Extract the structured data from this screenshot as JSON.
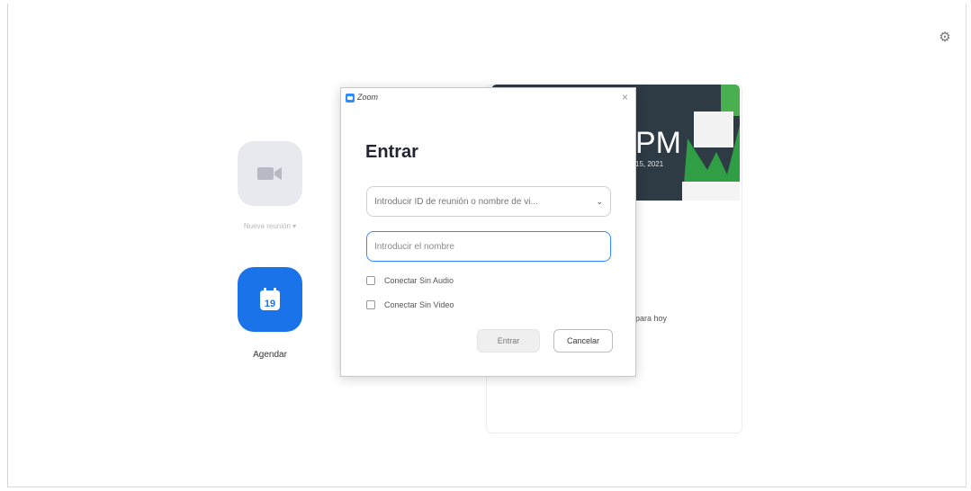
{
  "dialog": {
    "window_title": "Zoom",
    "close_glyph": "×",
    "heading": "Entrar",
    "meeting_select_placeholder": "Introducir ID de reunión o nombre de vi...",
    "name_placeholder": "Introducir el nombre",
    "checkbox_no_audio": "Conectar Sin Audio",
    "checkbox_no_video": "Conectar Sin Video",
    "join_button": "Entrar",
    "cancel_button": "Cancelar"
  },
  "launcher": {
    "new_meeting_label": "Nueva reunión ▾",
    "schedule_label": "Agendar",
    "schedule_day": "19"
  },
  "background_card": {
    "time": "PM",
    "date": "15, 2021",
    "text": "para hoy"
  },
  "colors": {
    "accent": "#2d8cff",
    "schedule_tile": "#1a73e8",
    "banner": "#2e3a44"
  }
}
